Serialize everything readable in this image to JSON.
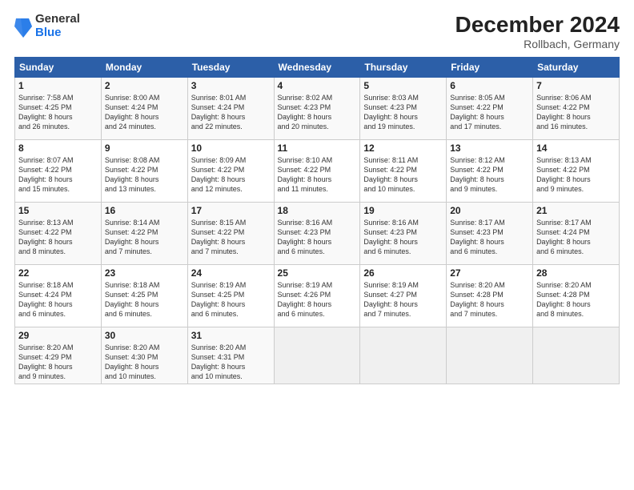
{
  "logo": {
    "general": "General",
    "blue": "Blue"
  },
  "header": {
    "month": "December 2024",
    "location": "Rollbach, Germany"
  },
  "weekdays": [
    "Sunday",
    "Monday",
    "Tuesday",
    "Wednesday",
    "Thursday",
    "Friday",
    "Saturday"
  ],
  "weeks": [
    [
      {
        "day": "1",
        "info": "Sunrise: 7:58 AM\nSunset: 4:25 PM\nDaylight: 8 hours\nand 26 minutes."
      },
      {
        "day": "2",
        "info": "Sunrise: 8:00 AM\nSunset: 4:24 PM\nDaylight: 8 hours\nand 24 minutes."
      },
      {
        "day": "3",
        "info": "Sunrise: 8:01 AM\nSunset: 4:24 PM\nDaylight: 8 hours\nand 22 minutes."
      },
      {
        "day": "4",
        "info": "Sunrise: 8:02 AM\nSunset: 4:23 PM\nDaylight: 8 hours\nand 20 minutes."
      },
      {
        "day": "5",
        "info": "Sunrise: 8:03 AM\nSunset: 4:23 PM\nDaylight: 8 hours\nand 19 minutes."
      },
      {
        "day": "6",
        "info": "Sunrise: 8:05 AM\nSunset: 4:22 PM\nDaylight: 8 hours\nand 17 minutes."
      },
      {
        "day": "7",
        "info": "Sunrise: 8:06 AM\nSunset: 4:22 PM\nDaylight: 8 hours\nand 16 minutes."
      }
    ],
    [
      {
        "day": "8",
        "info": "Sunrise: 8:07 AM\nSunset: 4:22 PM\nDaylight: 8 hours\nand 15 minutes."
      },
      {
        "day": "9",
        "info": "Sunrise: 8:08 AM\nSunset: 4:22 PM\nDaylight: 8 hours\nand 13 minutes."
      },
      {
        "day": "10",
        "info": "Sunrise: 8:09 AM\nSunset: 4:22 PM\nDaylight: 8 hours\nand 12 minutes."
      },
      {
        "day": "11",
        "info": "Sunrise: 8:10 AM\nSunset: 4:22 PM\nDaylight: 8 hours\nand 11 minutes."
      },
      {
        "day": "12",
        "info": "Sunrise: 8:11 AM\nSunset: 4:22 PM\nDaylight: 8 hours\nand 10 minutes."
      },
      {
        "day": "13",
        "info": "Sunrise: 8:12 AM\nSunset: 4:22 PM\nDaylight: 8 hours\nand 9 minutes."
      },
      {
        "day": "14",
        "info": "Sunrise: 8:13 AM\nSunset: 4:22 PM\nDaylight: 8 hours\nand 9 minutes."
      }
    ],
    [
      {
        "day": "15",
        "info": "Sunrise: 8:13 AM\nSunset: 4:22 PM\nDaylight: 8 hours\nand 8 minutes."
      },
      {
        "day": "16",
        "info": "Sunrise: 8:14 AM\nSunset: 4:22 PM\nDaylight: 8 hours\nand 7 minutes."
      },
      {
        "day": "17",
        "info": "Sunrise: 8:15 AM\nSunset: 4:22 PM\nDaylight: 8 hours\nand 7 minutes."
      },
      {
        "day": "18",
        "info": "Sunrise: 8:16 AM\nSunset: 4:23 PM\nDaylight: 8 hours\nand 6 minutes."
      },
      {
        "day": "19",
        "info": "Sunrise: 8:16 AM\nSunset: 4:23 PM\nDaylight: 8 hours\nand 6 minutes."
      },
      {
        "day": "20",
        "info": "Sunrise: 8:17 AM\nSunset: 4:23 PM\nDaylight: 8 hours\nand 6 minutes."
      },
      {
        "day": "21",
        "info": "Sunrise: 8:17 AM\nSunset: 4:24 PM\nDaylight: 8 hours\nand 6 minutes."
      }
    ],
    [
      {
        "day": "22",
        "info": "Sunrise: 8:18 AM\nSunset: 4:24 PM\nDaylight: 8 hours\nand 6 minutes."
      },
      {
        "day": "23",
        "info": "Sunrise: 8:18 AM\nSunset: 4:25 PM\nDaylight: 8 hours\nand 6 minutes."
      },
      {
        "day": "24",
        "info": "Sunrise: 8:19 AM\nSunset: 4:25 PM\nDaylight: 8 hours\nand 6 minutes."
      },
      {
        "day": "25",
        "info": "Sunrise: 8:19 AM\nSunset: 4:26 PM\nDaylight: 8 hours\nand 6 minutes."
      },
      {
        "day": "26",
        "info": "Sunrise: 8:19 AM\nSunset: 4:27 PM\nDaylight: 8 hours\nand 7 minutes."
      },
      {
        "day": "27",
        "info": "Sunrise: 8:20 AM\nSunset: 4:28 PM\nDaylight: 8 hours\nand 7 minutes."
      },
      {
        "day": "28",
        "info": "Sunrise: 8:20 AM\nSunset: 4:28 PM\nDaylight: 8 hours\nand 8 minutes."
      }
    ],
    [
      {
        "day": "29",
        "info": "Sunrise: 8:20 AM\nSunset: 4:29 PM\nDaylight: 8 hours\nand 9 minutes."
      },
      {
        "day": "30",
        "info": "Sunrise: 8:20 AM\nSunset: 4:30 PM\nDaylight: 8 hours\nand 10 minutes."
      },
      {
        "day": "31",
        "info": "Sunrise: 8:20 AM\nSunset: 4:31 PM\nDaylight: 8 hours\nand 10 minutes."
      },
      {
        "day": "",
        "info": ""
      },
      {
        "day": "",
        "info": ""
      },
      {
        "day": "",
        "info": ""
      },
      {
        "day": "",
        "info": ""
      }
    ]
  ]
}
